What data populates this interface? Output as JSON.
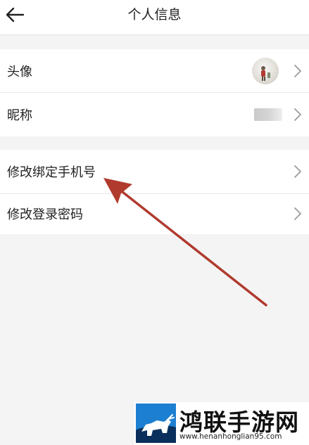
{
  "header": {
    "back_icon": "arrow-left-icon",
    "title": "个人信息"
  },
  "group1": {
    "rows": [
      {
        "label": "头像",
        "trailing": "avatar-image"
      },
      {
        "label": "昵称",
        "trailing": "blurred-nickname"
      }
    ]
  },
  "group2": {
    "rows": [
      {
        "label": "修改绑定手机号"
      },
      {
        "label": "修改登录密码"
      }
    ]
  },
  "annotation": {
    "type": "red-arrow",
    "color": "#b03a2e",
    "points_to": "修改绑定手机号"
  },
  "watermark": {
    "name": "鸿联手游网",
    "url": "www.henanhonglian95.com",
    "logo_colors": [
      "#1d7fd1",
      "#0b2f5c"
    ]
  },
  "colors": {
    "background": "#f4f4f4",
    "card": "#ffffff",
    "divider": "#e8e8e8",
    "chevron": "#9a9a9a"
  }
}
